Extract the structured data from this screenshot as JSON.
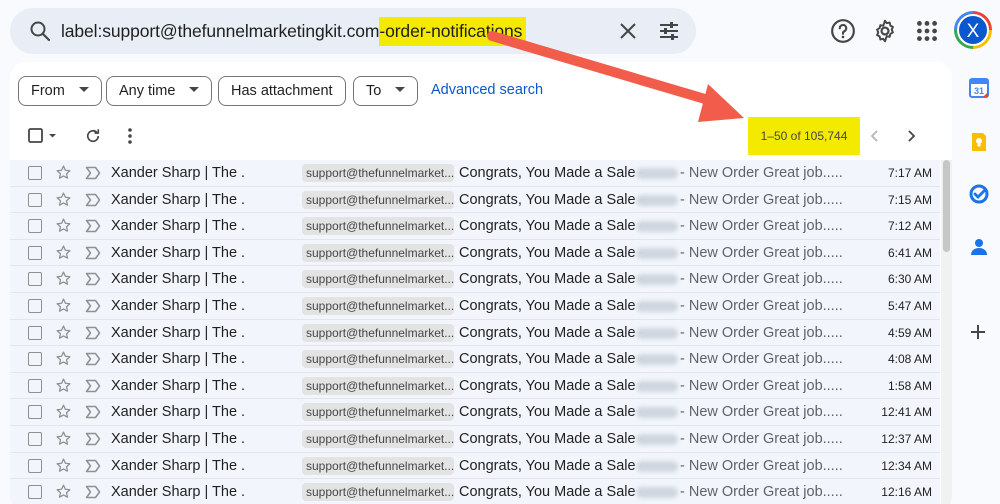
{
  "search": {
    "query_prefix": "label:support@thefunnelmarketingkit.com",
    "query_highlight": "-order-notifications"
  },
  "header": {
    "avatar_letter": "X"
  },
  "filters": {
    "chips": [
      "From",
      "Any time",
      "Has attachment",
      "To"
    ],
    "advanced": "Advanced search"
  },
  "toolbar": {
    "page_count": "1–50 of 105,744"
  },
  "emails": [
    {
      "sender": "Xander Sharp | The .",
      "label": "support@thefunnelmarket...",
      "subject": "Congrats, You Made a Sale -",
      "snippet": "- New Order Great job.....",
      "time": "7:17 AM"
    },
    {
      "sender": "Xander Sharp | The .",
      "label": "support@thefunnelmarket...",
      "subject": "Congrats, You Made a Sale -",
      "snippet": "- New Order Great job.....",
      "time": "7:15 AM"
    },
    {
      "sender": "Xander Sharp | The .",
      "label": "support@thefunnelmarket...",
      "subject": "Congrats, You Made a Sale -",
      "snippet": "- New Order Great job.....",
      "time": "7:12 AM"
    },
    {
      "sender": "Xander Sharp | The .",
      "label": "support@thefunnelmarket...",
      "subject": "Congrats, You Made a Sale -",
      "snippet": "- New Order Great job.....",
      "time": "6:41 AM"
    },
    {
      "sender": "Xander Sharp | The .",
      "label": "support@thefunnelmarket...",
      "subject": "Congrats, You Made a Sale -",
      "snippet": "- New Order Great job.....",
      "time": "6:30 AM"
    },
    {
      "sender": "Xander Sharp | The .",
      "label": "support@thefunnelmarket...",
      "subject": "Congrats, You Made a Sale -",
      "snippet": "- New Order Great job.....",
      "time": "5:47 AM"
    },
    {
      "sender": "Xander Sharp | The .",
      "label": "support@thefunnelmarket...",
      "subject": "Congrats, You Made a Sale -",
      "snippet": "- New Order Great job.....",
      "time": "4:59 AM"
    },
    {
      "sender": "Xander Sharp | The .",
      "label": "support@thefunnelmarket...",
      "subject": "Congrats, You Made a Sale -",
      "snippet": "- New Order Great job.....",
      "time": "4:08 AM"
    },
    {
      "sender": "Xander Sharp | The .",
      "label": "support@thefunnelmarket...",
      "subject": "Congrats, You Made a Sale -",
      "snippet": "- New Order Great job.....",
      "time": "1:58 AM"
    },
    {
      "sender": "Xander Sharp | The .",
      "label": "support@thefunnelmarket...",
      "subject": "Congrats, You Made a Sale -",
      "snippet": "- New Order Great job.....",
      "time": "12:41 AM"
    },
    {
      "sender": "Xander Sharp | The .",
      "label": "support@thefunnelmarket...",
      "subject": "Congrats, You Made a Sale -",
      "snippet": "- New Order Great job.....",
      "time": "12:37 AM"
    },
    {
      "sender": "Xander Sharp | The .",
      "label": "support@thefunnelmarket...",
      "subject": "Congrats, You Made a Sale -",
      "snippet": "- New Order Great job.....",
      "time": "12:34 AM"
    },
    {
      "sender": "Xander Sharp | The .",
      "label": "support@thefunnelmarket...",
      "subject": "Congrats, You Made a Sale -",
      "snippet": "- New Order Great job.....",
      "time": "12:16 AM"
    }
  ],
  "colors": {
    "highlight": "#f3ea00",
    "arrow": "#f25c4a",
    "link": "#0b57d0"
  }
}
